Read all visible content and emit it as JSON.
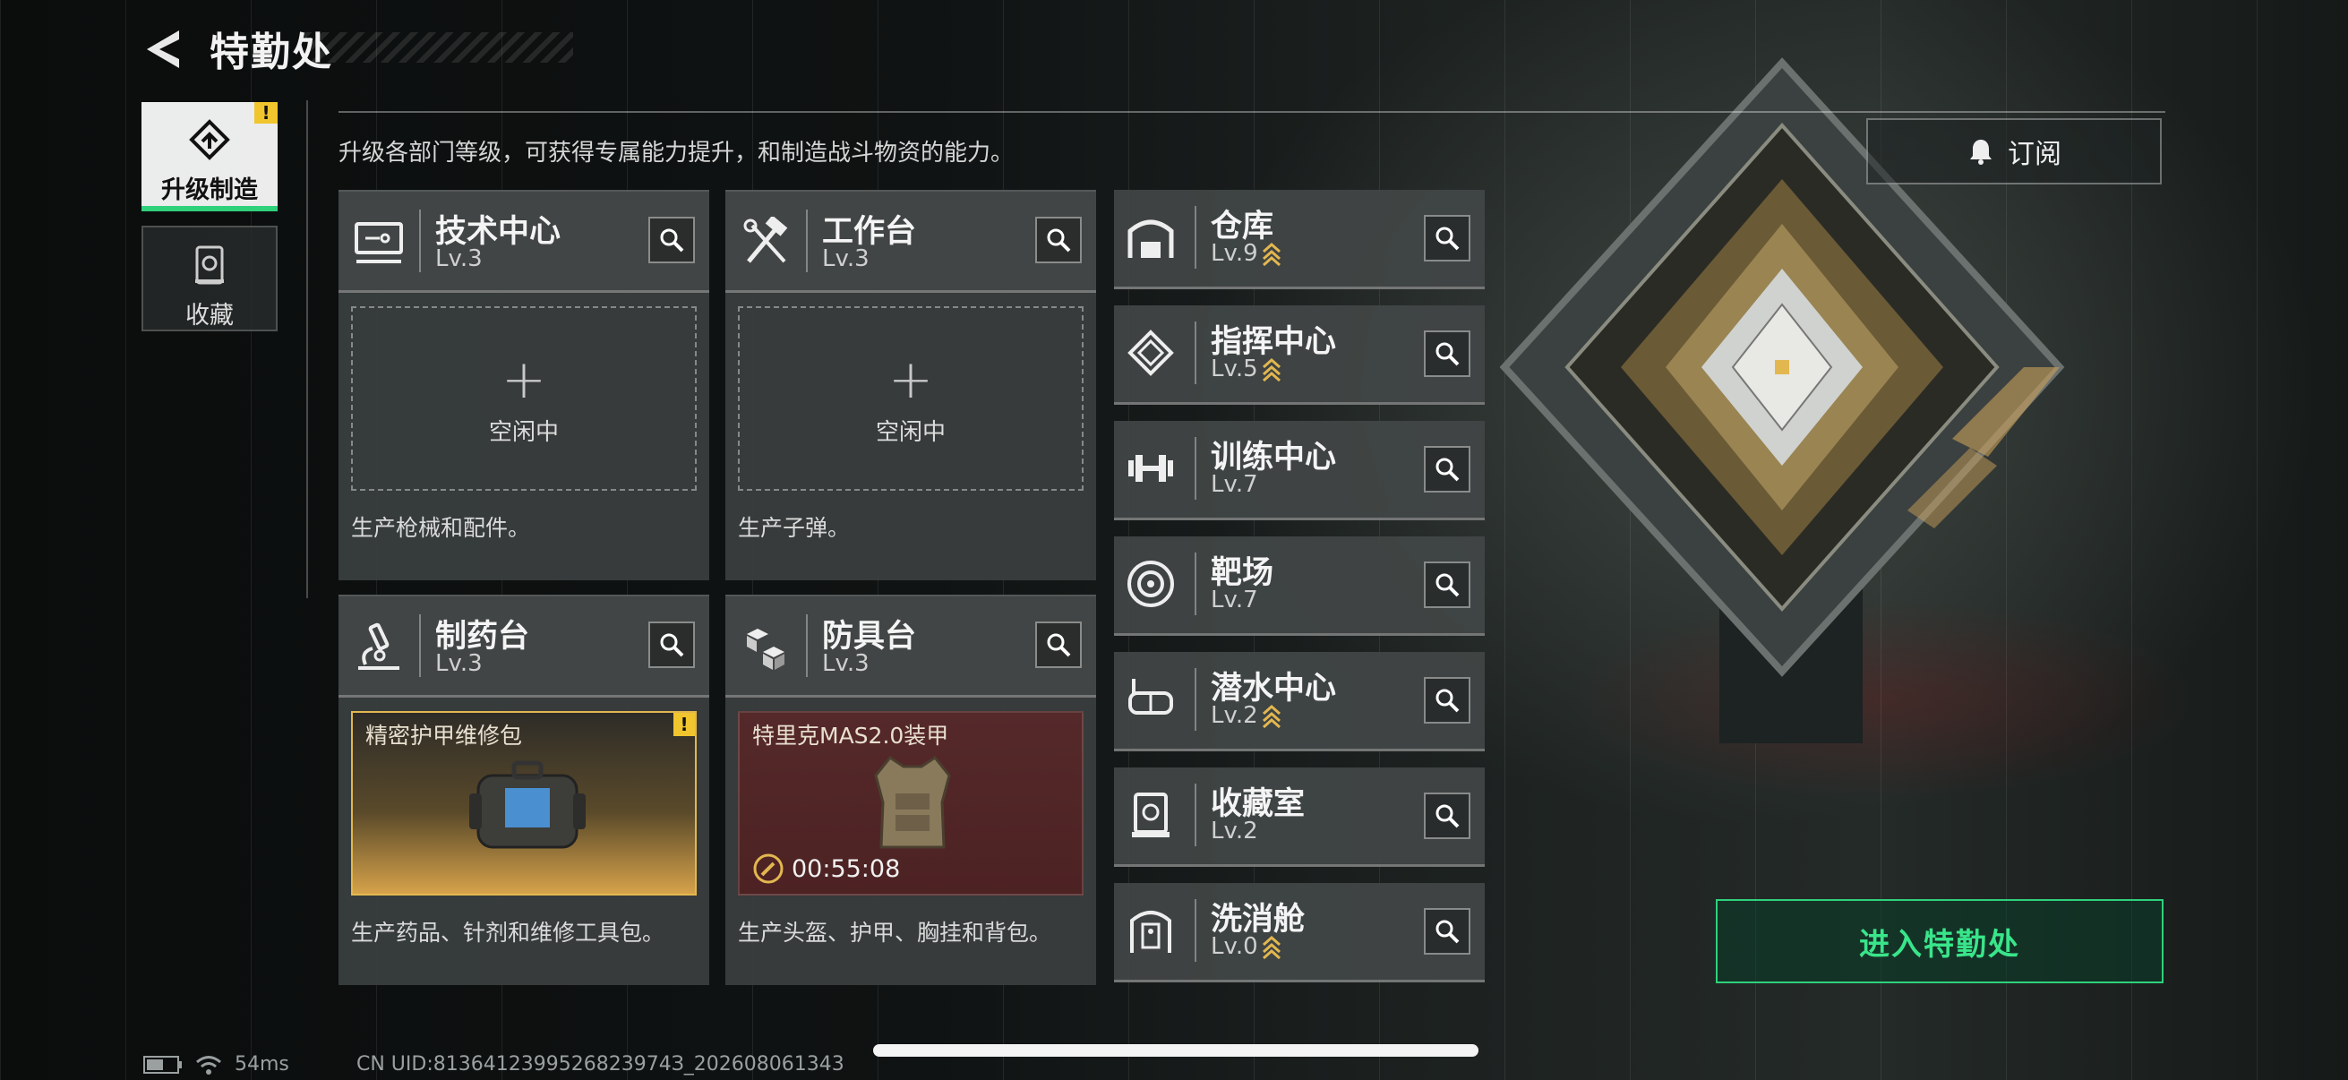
{
  "header": {
    "title": "特勤处"
  },
  "description": "升级各部门等级，可获得专属能力提升，和制造战斗物资的能力。",
  "tabs": [
    {
      "label": "升级制造",
      "badge": "!"
    },
    {
      "label": "收藏"
    }
  ],
  "subscribe_label": "订阅",
  "stations": [
    {
      "name": "技术中心",
      "level": "Lv.3",
      "slot_text": "空闲中",
      "desc": "生产枪械和配件。"
    },
    {
      "name": "工作台",
      "level": "Lv.3",
      "slot_text": "空闲中",
      "desc": "生产子弹。"
    },
    {
      "name": "制药台",
      "level": "Lv.3",
      "item": "精密护甲维修包",
      "badge": "!",
      "desc": "生产药品、针剂和维修工具包。"
    },
    {
      "name": "防具台",
      "level": "Lv.3",
      "item": "特里克MAS2.0装甲",
      "timer": "00:55:08",
      "desc": "生产头盔、护甲、胸挂和背包。"
    }
  ],
  "departments": [
    {
      "name": "仓库",
      "level": "Lv.9",
      "upgrade": true
    },
    {
      "name": "指挥中心",
      "level": "Lv.5",
      "upgrade": true
    },
    {
      "name": "训练中心",
      "level": "Lv.7",
      "upgrade": false
    },
    {
      "name": "靶场",
      "level": "Lv.7",
      "upgrade": false
    },
    {
      "name": "潜水中心",
      "level": "Lv.2",
      "upgrade": true
    },
    {
      "name": "收藏室",
      "level": "Lv.2",
      "upgrade": false
    },
    {
      "name": "洗消舱",
      "level": "Lv.0",
      "upgrade": true
    }
  ],
  "enter_label": "进入特勤处",
  "status": {
    "ping": "54ms",
    "uid": "CN UID:8136412399526823974З_202608061343"
  },
  "colors": {
    "accent_green": "#2fd17b",
    "warning_yellow": "#f0c52e",
    "upgrade_gold": "#e2b750"
  }
}
